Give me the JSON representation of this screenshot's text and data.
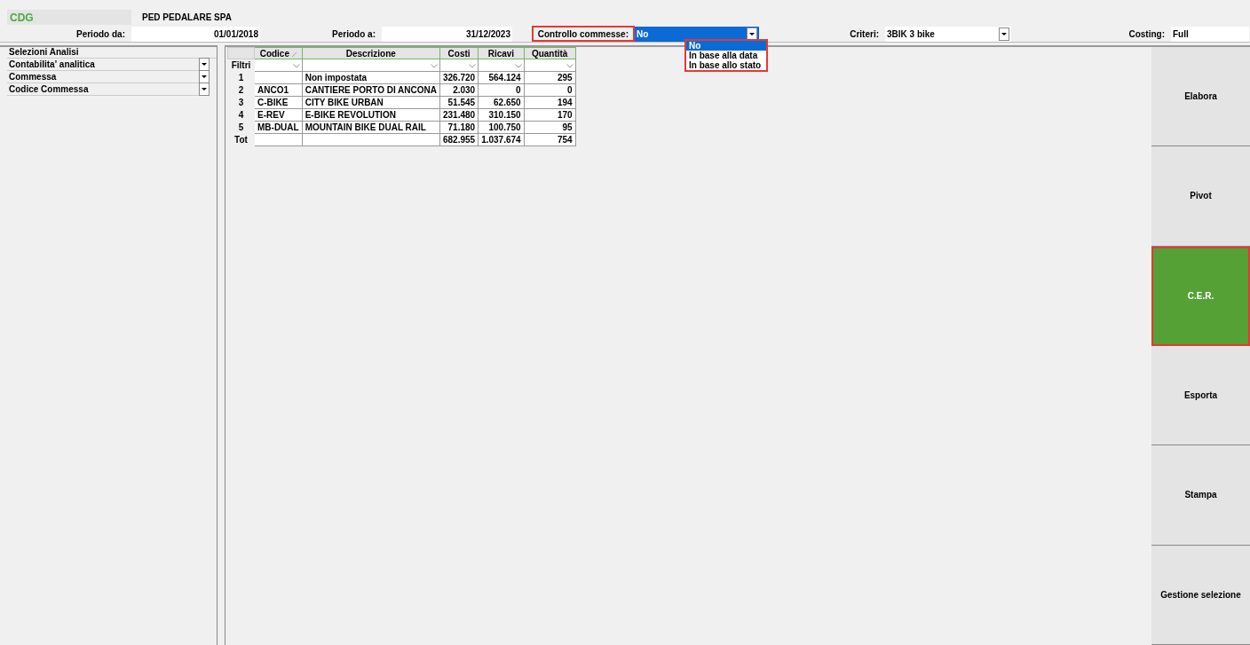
{
  "header": {
    "app_code": "CDG",
    "company": "PED PEDALARE SPA"
  },
  "fields": [
    {
      "label": "Periodo da:",
      "value": "01/01/2018",
      "kind": "text",
      "highlighted": false
    },
    {
      "label": "Periodo a:",
      "value": "31/12/2023",
      "kind": "text",
      "highlighted": false
    },
    {
      "label": "Controllo commesse:",
      "value": "No",
      "kind": "select",
      "highlighted": true,
      "focused": true
    },
    {
      "label": "Criteri:",
      "value": "3BIK 3 bike",
      "kind": "select",
      "highlighted": false,
      "focused": false
    },
    {
      "label": "Costing:",
      "value": "Full",
      "kind": "text",
      "highlighted": false
    }
  ],
  "dropdown": {
    "options": [
      {
        "label": "No",
        "selected": true
      },
      {
        "label": "In base alla data",
        "selected": false
      },
      {
        "label": "In base allo stato",
        "selected": false
      }
    ]
  },
  "selections": {
    "title": "Selezioni Analisi",
    "items": [
      {
        "label": "Contabilita' analitica"
      },
      {
        "label": "Commessa"
      },
      {
        "label": "Codice Commessa"
      }
    ]
  },
  "table": {
    "columns": [
      {
        "label": "Codice",
        "sorted": true
      },
      {
        "label": "Descrizione",
        "sorted": false
      },
      {
        "label": "Costi",
        "sorted": false
      },
      {
        "label": "Ricavi",
        "sorted": false
      },
      {
        "label": "Quantità",
        "sorted": false
      }
    ],
    "filter_label": "Filtri",
    "rows": [
      {
        "label": "1",
        "cells": [
          "",
          "Non impostata",
          "326.720",
          "564.124",
          "295"
        ]
      },
      {
        "label": "2",
        "cells": [
          "ANCO1",
          "CANTIERE PORTO DI ANCONA",
          "2.030",
          "0",
          "0"
        ]
      },
      {
        "label": "3",
        "cells": [
          "C-BIKE",
          "CITY BIKE URBAN",
          "51.545",
          "62.650",
          "194"
        ]
      },
      {
        "label": "4",
        "cells": [
          "E-REV",
          "E-BIKE REVOLUTION",
          "231.480",
          "310.150",
          "170"
        ]
      },
      {
        "label": "5",
        "cells": [
          "MB-DUAL",
          "MOUNTAIN BIKE DUAL RAIL",
          "71.180",
          "100.750",
          "95"
        ]
      },
      {
        "label": "Tot",
        "cells": [
          "",
          "",
          "682.955",
          "1.037.674",
          "754"
        ]
      }
    ]
  },
  "buttons": [
    {
      "label": "Elabora",
      "selected": false
    },
    {
      "label": "Pivot",
      "selected": false
    },
    {
      "label": "C.E.R.",
      "selected": true
    },
    {
      "label": "Esporta",
      "selected": false
    },
    {
      "label": "Stampa",
      "selected": false
    },
    {
      "label": "Gestione selezione",
      "selected": false
    }
  ]
}
